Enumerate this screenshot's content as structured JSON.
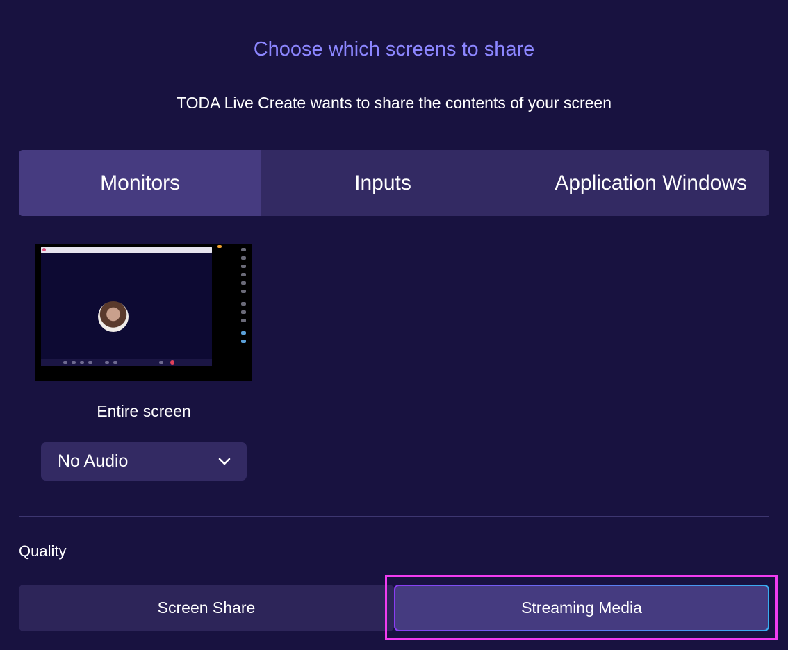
{
  "dialog": {
    "title": "Choose which screens to share",
    "subtitle": "TODA Live Create wants to share the contents of your screen"
  },
  "tabs": [
    {
      "label": "Monitors",
      "active": true
    },
    {
      "label": "Inputs",
      "active": false
    },
    {
      "label": "Application Windows",
      "active": false
    }
  ],
  "monitor": {
    "label": "Entire screen"
  },
  "audio": {
    "selected": "No Audio",
    "icon": "chevron-down-icon"
  },
  "quality": {
    "label": "Quality",
    "options": [
      {
        "label": "Screen Share",
        "selected": false
      },
      {
        "label": "Streaming Media",
        "selected": true
      }
    ]
  },
  "colors": {
    "background": "#181240",
    "title": "#8c86ff",
    "tab_active": "#463b80",
    "tab_inactive": "#332a63",
    "highlight": "#f03cf0"
  }
}
